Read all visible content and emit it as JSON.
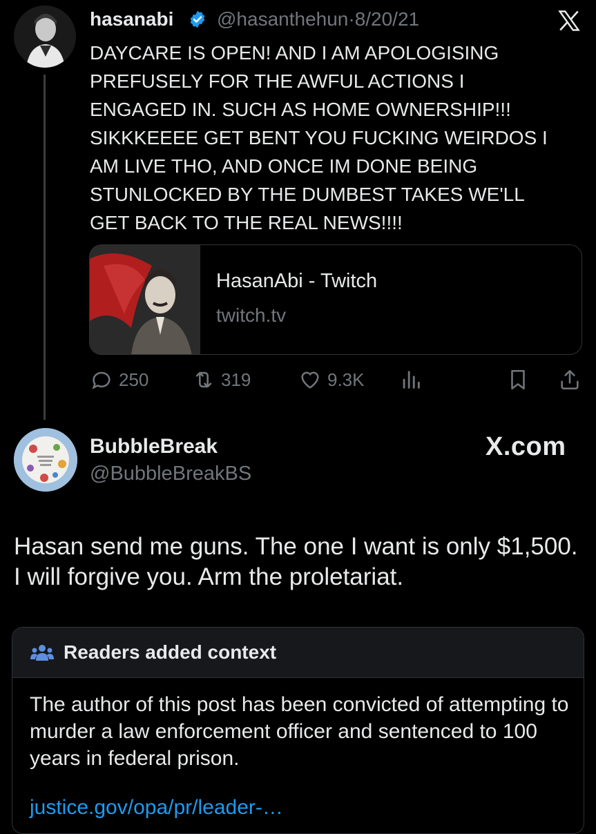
{
  "quoted_tweet": {
    "display_name": "hasanabi",
    "handle": "@hasanthehun",
    "separator": "·",
    "date": "8/20/21",
    "text": "DAYCARE IS OPEN! AND I AM APOLOGISING\nPREFUSELY FOR THE AWFUL ACTIONS I\nENGAGED IN. SUCH AS HOME OWNERSHIP!!!\nSIKKKEEEE GET BENT YOU FUCKING WEIRDOS I\nAM LIVE THO, AND ONCE IM DONE BEING\nSTUNLOCKED BY THE DUMBEST TAKES WE'LL\nGET BACK TO THE REAL NEWS!!!!",
    "link_card": {
      "title": "HasanAbi - Twitch",
      "domain": "twitch.tv"
    },
    "actions": {
      "replies": "250",
      "retweets": "319",
      "likes": "9.3K"
    },
    "verified_color": "#1d9bf0"
  },
  "main_tweet": {
    "display_name": "BubbleBreak",
    "handle": "@BubbleBreakBS",
    "watermark": "X.com",
    "text": "Hasan send me guns. The one I want is only $1,500. I will forgive you. Arm the proletariat."
  },
  "community_note": {
    "title": "Readers added context",
    "text": "The author of this post has been convicted of attempting to murder a law enforcement officer and sentenced to 100 years in federal prison.",
    "link": "justice.gov/opa/pr/leader-…",
    "link_color": "#1d9bf0"
  },
  "icons": {
    "verified": "verified-badge-icon",
    "x_logo": "x-logo-icon",
    "reply": "reply-icon",
    "retweet": "retweet-icon",
    "like": "heart-icon",
    "views": "views-icon",
    "bookmark": "bookmark-icon",
    "share": "share-icon",
    "readers": "people-icon"
  }
}
